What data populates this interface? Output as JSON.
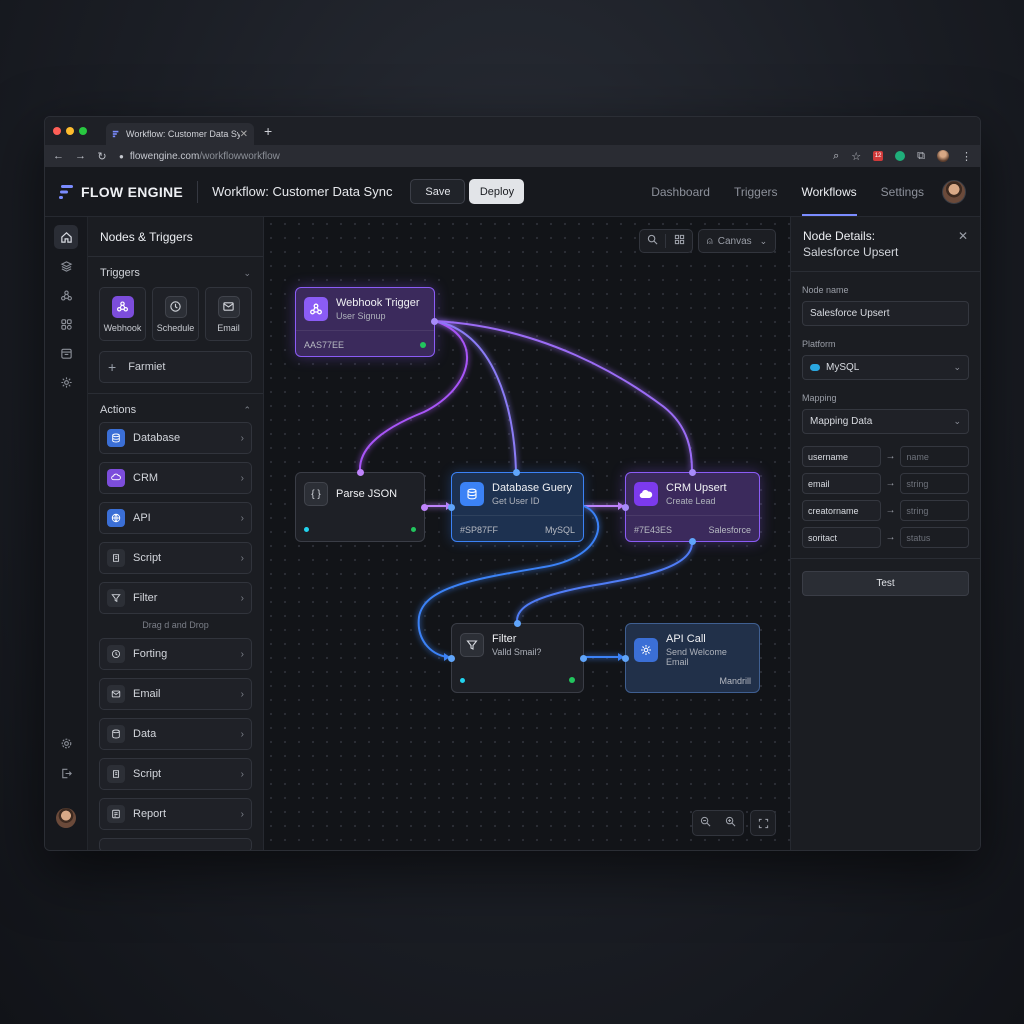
{
  "browser": {
    "tab_title": "Workflow: Customer Data Sync",
    "new_tab": "+",
    "url_host": "flowengine.com",
    "url_path": "/workflowworkflow",
    "ext_badge": "12"
  },
  "app": {
    "brand": "FLOW ENGINE",
    "workflow_title": "Workflow: Customer Data Sync",
    "save_label": "Save",
    "deploy_label": "Deploy",
    "nav": [
      "Dashboard",
      "Triggers",
      "Workflows",
      "Settings"
    ],
    "active_nav": "Workflows"
  },
  "panel": {
    "title": "Nodes & Triggers",
    "triggers_heading": "Triggers",
    "triggers": [
      {
        "label": "Webhook",
        "icon": "webhook-icon"
      },
      {
        "label": "Schedule",
        "icon": "clock-icon"
      },
      {
        "label": "Email",
        "icon": "mail-icon"
      }
    ],
    "add_label": "Farmiet",
    "actions_heading": "Actions",
    "actions": [
      {
        "label": "Database",
        "icon": "database-icon"
      },
      {
        "label": "CRM",
        "icon": "crm-icon"
      },
      {
        "label": "API",
        "icon": "globe-icon"
      },
      {
        "label": "Script",
        "icon": "script-icon"
      },
      {
        "label": "Filter",
        "icon": "filter-icon"
      }
    ],
    "dnd_hint": "Drag d and Drop",
    "more_actions": [
      {
        "label": "Forting",
        "icon": "clock-icon"
      },
      {
        "label": "Email",
        "icon": "mail-icon"
      },
      {
        "label": "Data",
        "icon": "database-icon"
      },
      {
        "label": "Script",
        "icon": "script-icon"
      },
      {
        "label": "Report",
        "icon": "report-icon"
      }
    ]
  },
  "canvas": {
    "mode_label": "Canvas",
    "nodes": {
      "webhook": {
        "title": "Webhook Trigger",
        "subtitle": "User Signup",
        "id": "AAS77EE"
      },
      "parse": {
        "title": "Parse JSON",
        "icon_text": "{ }"
      },
      "dbquery": {
        "title": "Database Guery",
        "subtitle": "Get User ID",
        "id": "#SP87FF",
        "service": "MySQL"
      },
      "crm": {
        "title": "CRM Upsert",
        "subtitle": "Create Lead",
        "id": "#7E43ES",
        "service": "Salesforce"
      },
      "filter": {
        "title": "Filter",
        "subtitle": "Valld Smail?"
      },
      "apicall": {
        "title": "API Call",
        "subtitle": "Send Welcome Email",
        "service": "Mandrill"
      }
    }
  },
  "details": {
    "title": "Node Details:",
    "subtitle": "Salesforce Upsert",
    "node_name_label": "Node name",
    "node_name_value": "Salesforce Upsert",
    "platform_label": "Platform",
    "platform_value": "MySQL",
    "mapping_label": "Mapping",
    "mapping_value": "Mapping Data",
    "mappings": [
      {
        "key": "username",
        "value": "name"
      },
      {
        "key": "email",
        "value": "string"
      },
      {
        "key": "creatorname",
        "value": "string"
      },
      {
        "key": "soritact",
        "value": "status"
      }
    ],
    "test_label": "Test"
  },
  "colors": {
    "accent": "#8b5cf6",
    "blue": "#3b82f6",
    "status_green": "#22c55e"
  }
}
